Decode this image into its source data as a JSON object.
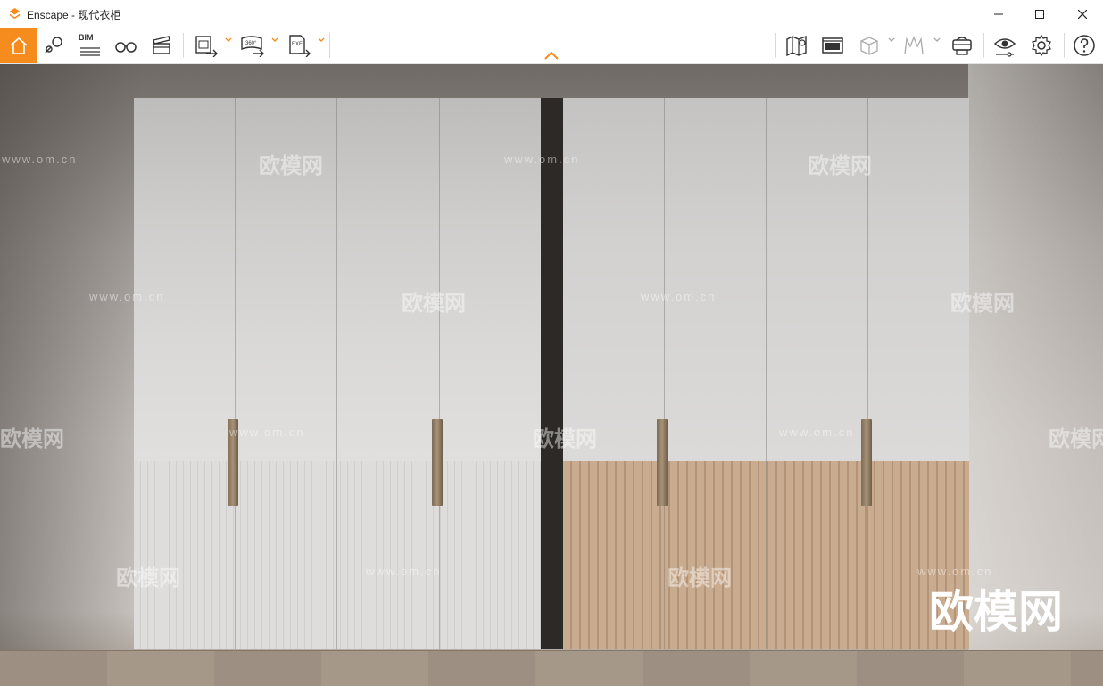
{
  "window": {
    "title": "Enscape - 现代衣柜"
  },
  "toolbar": {
    "left_items": [
      {
        "name": "home",
        "icon": "home-icon"
      },
      {
        "name": "navigation",
        "icon": "map-pin-icon"
      },
      {
        "name": "bim",
        "icon": "bim-icon",
        "label": "BIM"
      },
      {
        "name": "views",
        "icon": "binoculars-icon"
      },
      {
        "name": "video",
        "icon": "clapperboard-icon"
      },
      {
        "name": "screenshot-export",
        "icon": "image-export-icon"
      },
      {
        "name": "panorama-export",
        "icon": "panorama-export-icon",
        "label": "360°"
      },
      {
        "name": "exe-export",
        "icon": "exe-export-icon",
        "label": "EXE"
      }
    ],
    "right_items": [
      {
        "name": "map",
        "icon": "map-icon"
      },
      {
        "name": "asset-library",
        "icon": "asset-library-icon"
      },
      {
        "name": "material",
        "icon": "cube-icon"
      },
      {
        "name": "people",
        "icon": "people-icon"
      },
      {
        "name": "vr-headset",
        "icon": "vr-headset-icon"
      },
      {
        "name": "visual-settings",
        "icon": "eye-settings-icon"
      },
      {
        "name": "settings",
        "icon": "gear-icon"
      },
      {
        "name": "help",
        "icon": "help-icon"
      }
    ],
    "accent_color": "#f68b1e"
  },
  "viewport": {
    "watermark_text": "欧模网",
    "watermark_url": "www.om.cn",
    "scene": "two wardrobes, white and wood lower panels"
  }
}
